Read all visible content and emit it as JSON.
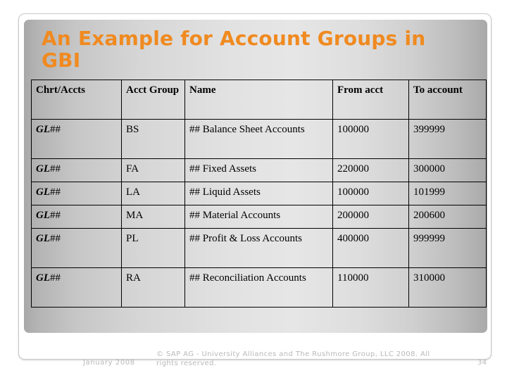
{
  "slide": {
    "title": "An Example for Account Groups in GBI",
    "accent_color": "#f08a20",
    "panel_color_light": "#e6e6e6",
    "panel_color_dark": "#a8a8a8"
  },
  "table": {
    "headers": {
      "chrt_accts": "Chrt/Accts",
      "acct_group": "Acct Group",
      "name": "Name",
      "from_acct": "From acct",
      "to_account": "To account"
    },
    "rows": [
      {
        "chrt_prefix": "GL",
        "chrt_suffix": "##",
        "group": "BS",
        "name": "## Balance Sheet Accounts",
        "from": "100000",
        "to": "399999"
      },
      {
        "chrt_prefix": "GL",
        "chrt_suffix": "##",
        "group": "FA",
        "name": "## Fixed Assets",
        "from": "220000",
        "to": "300000"
      },
      {
        "chrt_prefix": "GL",
        "chrt_suffix": "##",
        "group": "LA",
        "name": "## Liquid Assets",
        "from": "100000",
        "to": "101999"
      },
      {
        "chrt_prefix": "GL",
        "chrt_suffix": "##",
        "group": "MA",
        "name": "## Material Accounts",
        "from": "200000",
        "to": "200600"
      },
      {
        "chrt_prefix": "GL",
        "chrt_suffix": "##",
        "group": "PL",
        "name": "## Profit & Loss Accounts",
        "from": "400000",
        "to": "999999"
      },
      {
        "chrt_prefix": "GL",
        "chrt_suffix": "##",
        "group": "RA",
        "name": "## Reconciliation Accounts",
        "from": "110000",
        "to": "310000"
      }
    ]
  },
  "footer": {
    "date": "January 2008",
    "copyright": "© SAP AG - University Alliances and The Rushmore Group, LLC 2008. All rights reserved.",
    "page_number": "34"
  }
}
